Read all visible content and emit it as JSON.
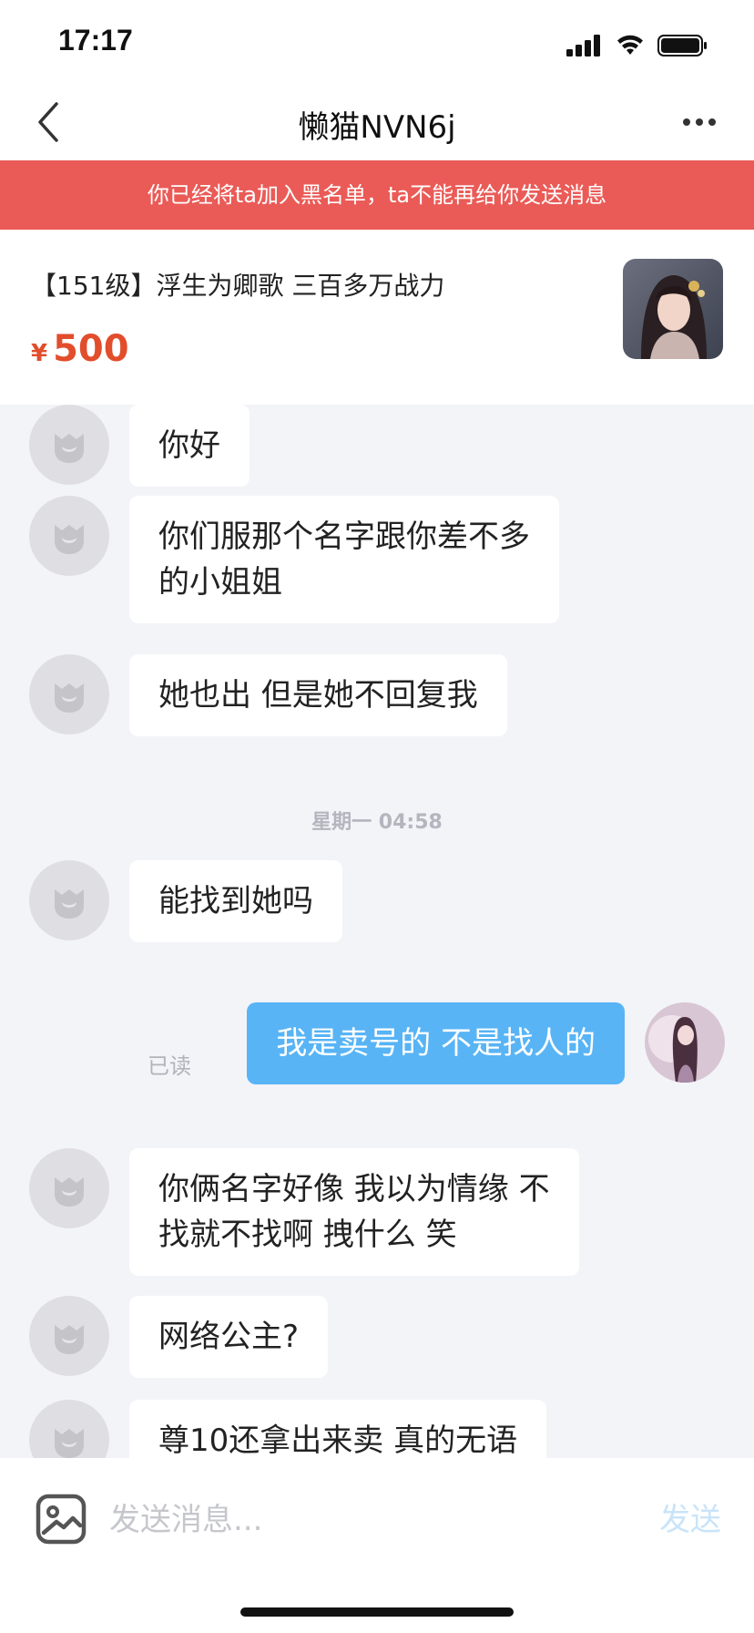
{
  "status_bar": {
    "time": "17:17"
  },
  "nav": {
    "title": "懒猫NVN6j"
  },
  "banner": {
    "text": "你已经将ta加入黑名单，ta不能再给你发送消息"
  },
  "product": {
    "title": "【151级】浮生为卿歌 三百多万战力",
    "currency": "¥",
    "price": "500"
  },
  "messages": [
    {
      "from": "other",
      "text": "你好"
    },
    {
      "from": "other",
      "text": "你们服那个名字跟你差不多\n的小姐姐"
    },
    {
      "from": "other",
      "text": "她也出 但是她不回复我"
    },
    {
      "timestamp": "星期一 04:58"
    },
    {
      "from": "other",
      "text": "能找到她吗"
    },
    {
      "from": "me",
      "text": "我是卖号的 不是找人的",
      "status": "已读"
    },
    {
      "from": "other",
      "text": "你俩名字好像 我以为情缘 不\n找就不找啊 拽什么 笑"
    },
    {
      "from": "other",
      "text": "网络公主?"
    },
    {
      "from": "other",
      "text": "尊10还拿出来卖 真的无语"
    }
  ],
  "input": {
    "placeholder": "发送消息...",
    "send_label": "发送"
  },
  "colors": {
    "banner": "#ea5b57",
    "my_bubble": "#58b4f5",
    "price": "#e24d2c"
  }
}
